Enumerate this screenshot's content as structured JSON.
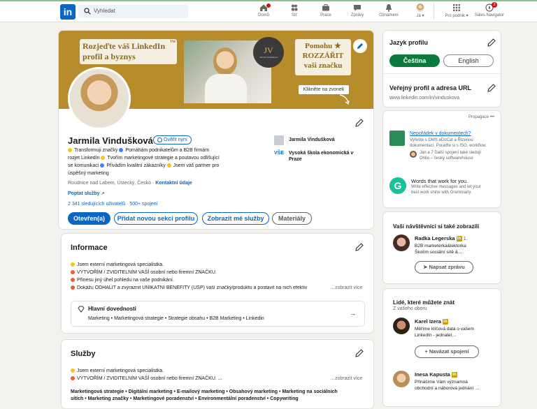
{
  "nav": {
    "logo": "in",
    "search_placeholder": "Vyhledat",
    "items": [
      {
        "label": "Domů",
        "icon": "home-icon"
      },
      {
        "label": "Síť",
        "icon": "network-icon"
      },
      {
        "label": "Práce",
        "icon": "briefcase-icon"
      },
      {
        "label": "Zprávy",
        "icon": "messages-icon"
      },
      {
        "label": "Oznámení",
        "icon": "bell-icon"
      },
      {
        "label": "Já ▾",
        "icon": "avatar"
      },
      {
        "label": "Pro podnik ▾",
        "icon": "grid-icon"
      },
      {
        "label": "Sales Navigator",
        "icon": "compass-icon"
      }
    ],
    "sales_badge": "3"
  },
  "banner": {
    "line1": "Rozjeďte váš LinkedIn",
    "line2": "profil a byznys",
    "tm": "TM",
    "right1": "Pomohu ★",
    "right2": "ROZZÁŘIT",
    "right3": "vaši značku",
    "logo_text": "JV",
    "logo_sub": "Jarmila Vindušková",
    "cta": "Klikněte na zvonek"
  },
  "profile": {
    "name": "Jarmila Vindušková",
    "verify": "Ověřit nyní",
    "headline": [
      "Transformuji značky",
      "Pomáhám podnikatelům a B2B firmám",
      "rozjet LinkedIn",
      "Tvořím marketingové strategie a poutavou odlišující",
      "se komunikaci",
      "Přivádím kvalitní zákazníky",
      "Jsem váš partner pro",
      "úspěšný marketing"
    ],
    "location": "Roudnice nad Labem, Ústecký, Česko",
    "contact": "Kontaktní údaje",
    "services_link": "Poptat služby",
    "followers": "2 341 sledujících uživatelů",
    "connections": "500+ spojení",
    "company": "Jarmila Vindušková",
    "school_line1": "Vysoká škola ekonomická v",
    "school_line2": "Praze",
    "buttons": [
      "Otevřen(a)",
      "Přidat novou sekci profilu",
      "Zobrazit mé služby",
      "Materiály"
    ]
  },
  "info": {
    "title": "Informace",
    "lines": [
      "Jsem externí marketingová specialistka.",
      "VYTVOŘÍM / ZVIDITELNÍM VAŠÍ osobní nebo firemní ZNAČKU.",
      "Přinesu jiný úhel pohledu na vaše podnikání.",
      "Dokážu ODHALIT a zvýraznit UNIKÁTNÍ BENEFITY (USP) vaší značky/produktu a postavit na nich efektiv"
    ],
    "more": "…zobrazit více",
    "skills_title": "Hlavní dovednosti",
    "skills": "Marketing • Marketingová strategie • Strategie obsahu • B2B Marketing • Linkedin"
  },
  "services": {
    "title": "Služby",
    "lines": [
      "Jsem externí marketingová specialistka.",
      "VYTVOŘÍM / ZVIDITELNÍM VAŠÍ osobní nebo firemní ZNAČKU. ..."
    ],
    "more": "…zobrazit více",
    "list1": "Marketingová strategie • Digitální marketing • E-mailový marketing • Obsahový marketing • Marketing na sociálních",
    "list2": "sítích • Marketing značky • Marketingové poradenství • Environmentální poradenství • Copywriting"
  },
  "sidebar": {
    "lang_title": "Jazyk profilu",
    "lang_options": [
      "Čeština",
      "English"
    ],
    "public_title": "Veřejný profil a adresa URL",
    "public_url": "www.linkedin.com/in/vinduskova",
    "promo_label": "Propagace",
    "promo_more": "•••",
    "ad1_title": "Nepořádek v dokumentech?",
    "ad1_text1": "Vyřešte s DMS eDoCat a Řízenou",
    "ad1_text2": "dokumentací. Poraďte si s ISO, workflow.",
    "ad1_social1": "Jan a 7 Další spojení také sledují",
    "ad1_social2": "Onlio – český softwarehouse",
    "ad2_title": "Words that work for you.",
    "ad2_text1": "Write effective messages and let your",
    "ad2_text2": "best work shine with Grammarly.",
    "viewers_title": "Vaši návštěvníci si také zobrazili",
    "viewer_name": "Radka Legerska",
    "viewer_degree": "1.",
    "viewer_text1": "B2B marketérka&lektorka",
    "viewer_text2": "Školím sociální sítě &…",
    "viewer_btn": "Napsat zprávu",
    "pymk_title": "Lidé, které můžete znát",
    "pymk_sub": "Z vašeho oboru",
    "p1_name": "Karel Izera",
    "p1_text1": "Měříme klíčová data o vašem",
    "p1_text2": "LinkedIn - jednatel…",
    "p1_btn": "Navázat spojení",
    "p2_name": "Inesa Kapusta",
    "p2_text1": "Přinášíme Vám významná",
    "p2_text2": "obchodní a náborová jednání …"
  },
  "colors": {
    "brand": "#0a66c2",
    "banner": "#b78d2b",
    "bg": "#f3f2ef"
  }
}
